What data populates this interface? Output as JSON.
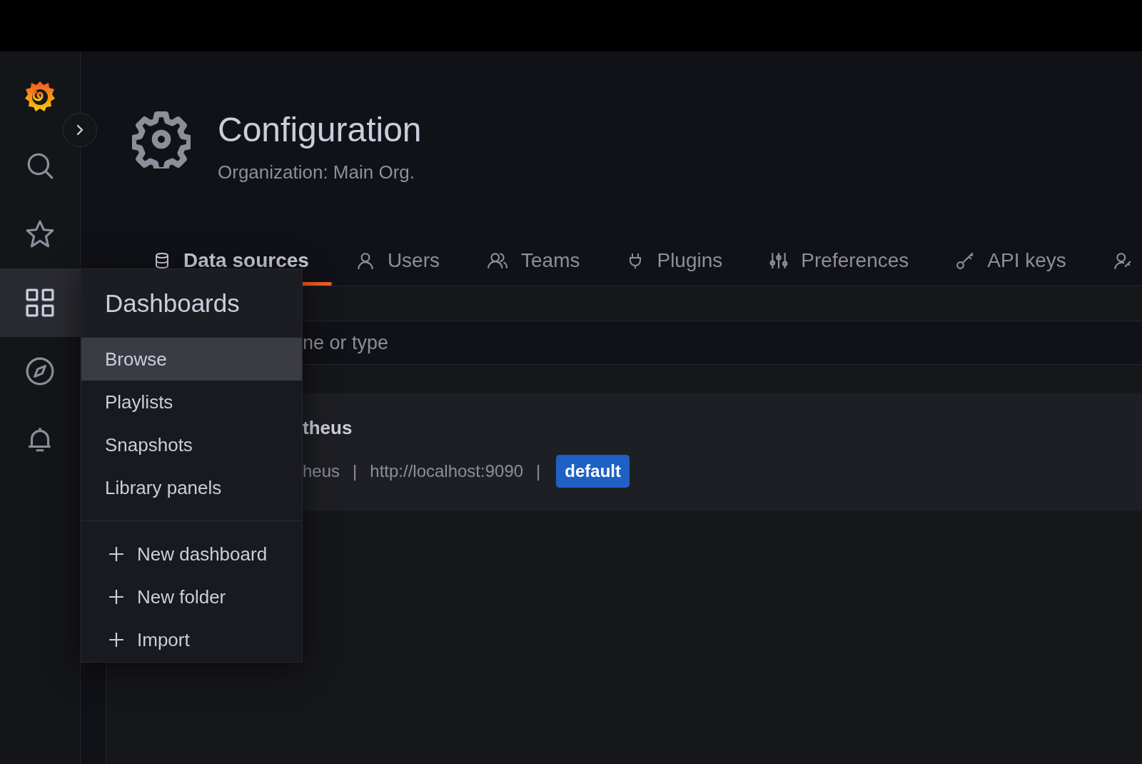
{
  "sidebar": {
    "items": [
      {
        "kind": "search",
        "selected": false
      },
      {
        "kind": "star",
        "selected": false
      },
      {
        "kind": "dashboards",
        "selected": true
      },
      {
        "kind": "explore",
        "selected": false
      },
      {
        "kind": "alerting",
        "selected": false
      }
    ]
  },
  "header": {
    "title": "Configuration",
    "subtitle": "Organization: Main Org."
  },
  "tabs": [
    {
      "kind": "database",
      "label": "Data sources",
      "selected": true
    },
    {
      "kind": "user",
      "label": "Users",
      "selected": false
    },
    {
      "kind": "users",
      "label": "Teams",
      "selected": false
    },
    {
      "kind": "plug",
      "label": "Plugins",
      "selected": false
    },
    {
      "kind": "sliders",
      "label": "Preferences",
      "selected": false
    },
    {
      "kind": "key",
      "label": "API keys",
      "selected": false
    },
    {
      "kind": "user-key",
      "selected": false
    }
  ],
  "search": {
    "placeholder": "ne or type"
  },
  "data_sources": [
    {
      "name": "theus",
      "type": "heus",
      "separator_1": "|",
      "url": "http://localhost:9090",
      "separator_2": "|",
      "badge": "default"
    }
  ],
  "menu": {
    "title": "Dashboards",
    "items": [
      {
        "label": "Browse",
        "selected": true
      },
      {
        "label": "Playlists",
        "selected": false
      },
      {
        "label": "Snapshots",
        "selected": false
      },
      {
        "label": "Library panels",
        "selected": false
      }
    ],
    "actions": [
      {
        "label": "New dashboard"
      },
      {
        "label": "New folder"
      },
      {
        "label": "Import"
      }
    ]
  }
}
